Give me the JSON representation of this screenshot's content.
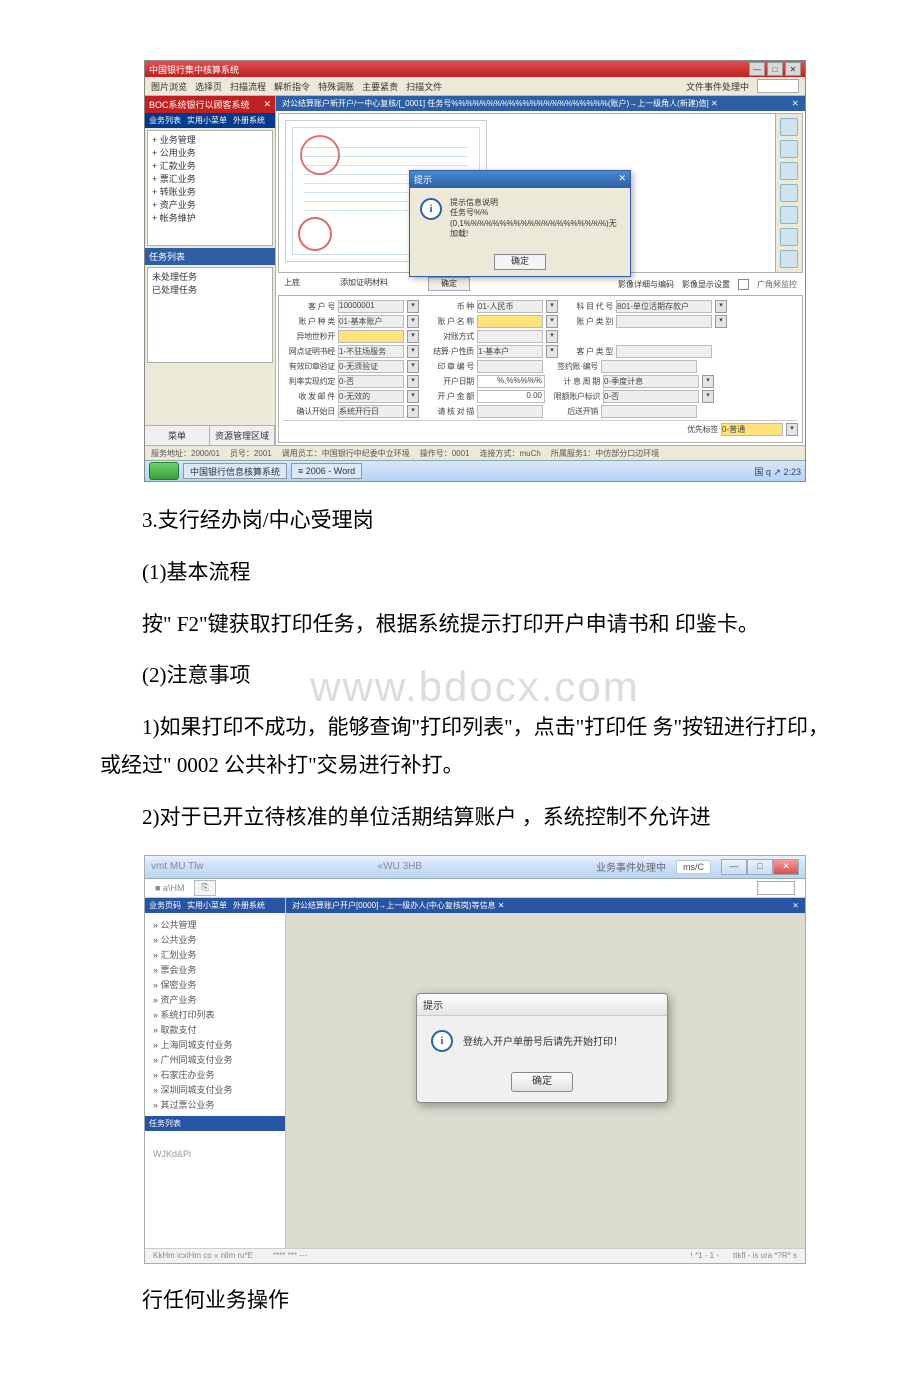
{
  "screenshot1": {
    "window_title": "中国银行集中核算系统",
    "menu": [
      "图片浏览",
      "选择页",
      "扫描流程",
      "解析指令",
      "特殊调账",
      "主要紧责",
      "扫描文件"
    ],
    "menu_right": "文件事件处理中",
    "toolbar": [
      "",
      ""
    ],
    "sidebar": {
      "header": "BOC系统银行以顾客系统",
      "sub_tabs": [
        "业务列表",
        "实用小菜单",
        "外册系统"
      ],
      "tree": [
        "+ 业务管理",
        "+ 公用业务",
        "+ 汇款业务",
        "+ 票汇业务",
        "+ 转账业务",
        "+ 资产业务",
        "+ 帐务维护"
      ],
      "task_header": "任务列表",
      "tasks": [
        "未处理任务",
        "已处理任务"
      ],
      "bottom_buttons": [
        "菜单",
        "资源管理区域"
      ]
    },
    "content": {
      "tab": "对公结算账户新开户/一中心复核/[_0001] 任务号%%%%%%%%%%%%%%%%%%%%%%(账户)→上一级角人(新建)值] ✕",
      "img_label_left": "上底",
      "img_label_left2": "添加证明材料",
      "img_nav_btn": "确定",
      "img_nav_prev": "影像详细与编码",
      "img_nav_next": "影像显示设置",
      "img_toggle": "广角频监控"
    },
    "dialog": {
      "title": "提示",
      "message_line1": "提示信息说明",
      "message_line2": "任务号%%(0,1%%%%%%%%%%%%%%%%%%%%)无加载!",
      "ok": "确定"
    },
    "form": {
      "rows": [
        {
          "l1": "客 户 号",
          "v1": "10000001",
          "l2": "币    种",
          "v2": "01-人民币",
          "l3": "科 目 代 号",
          "v3": "801-单位活期存款户"
        },
        {
          "l1": "账 户 种 类",
          "v1": "01-基本账户",
          "l2": "账 户 名 称",
          "v2": "",
          "l3": "账 户 类 别",
          "v3": ""
        },
        {
          "l1": "异地世秒开",
          "v1": "",
          "l2": "对账方式",
          "v2": "",
          "l3": "",
          "v3": ""
        },
        {
          "l1": "网点证明书经",
          "v1": "1-不驻场服务",
          "l2": "结算·户性质",
          "v2": "1-基本户",
          "l3": "客 户 类 型",
          "v3": ""
        },
        {
          "l1": "有效印章验证",
          "v1": "0-无须验证",
          "l2": "印 章 编 号",
          "v2": "",
          "l3": "签约账·编号",
          "v3": ""
        },
        {
          "l1": "利率实现约定",
          "v1": "0-否",
          "l2": "开户日期",
          "v2": "%,%%%%%",
          "l3": "计 息 周 期",
          "v3": "0-季度计息"
        },
        {
          "l1": "收 发 邮 件",
          "v1": "0-无效的",
          "l2": "开 户 金 额",
          "v2": "0.00",
          "l3": "限额账户标识",
          "v3": "0-否"
        },
        {
          "l1": "确认开始日",
          "v1": "系统开行日",
          "l2": "请 核 对 描",
          "v2": "",
          "l3": "后送开销",
          "v3": ""
        }
      ],
      "footer_l": "",
      "footer_r_lbl": "优先标签",
      "footer_r_val": "0-普通"
    },
    "statusbar": {
      "items": [
        "服务地址：2000/01",
        "员号：2001",
        "调用员工：中国银行中纪委中立环境",
        "操作号：0001",
        "连接方式：muCh",
        "所属服务1：中仿部分口边环境"
      ]
    },
    "taskbar": {
      "items": [
        "中国银行信息核算系统"
      ],
      "tray": "国 q ↗ 2:23"
    }
  },
  "body_text": {
    "p1": "3.支行经办岗/中心受理岗",
    "p2": "(1)基本流程",
    "p3": "按\" F2\"键获取打印任务，根据系统提示打印开户申请书和 印鉴卡。",
    "p4": "(2)注意事项",
    "p5": "1)如果打印不成功，能够查询\"打印列表\"，点击\"打印任 务\"按钮进行打印，或经过\" 0002 公共补打\"交易进行补打。",
    "p6": "2)对于已开立待核准的单位活期结算账户 ，系统控制不允许进",
    "p7": "行任何业务操作",
    "watermark": "www.bdocx.com"
  },
  "screenshot2": {
    "title_left": "vmt MU Tlw",
    "title_mid": "«WU 3HB",
    "title_right_status": "业务事件处理中",
    "title_right_pill": "ms/C",
    "subrow_left": "■ a\\HM",
    "subrow_tab": "⎘",
    "subrow_right": "",
    "sidebar": {
      "head_tabs": [
        "业务页码",
        "实用小菜单",
        "外册系统"
      ],
      "tree": [
        "» 公共管理",
        "» 公共业务",
        "» 汇划业务",
        "» 票会业务",
        "» 保密业务",
        "» 资产业务",
        "» 系统打印列表",
        "» 取款支付",
        "» 上海同城支付业务",
        "» 广州同城支付业务",
        "» 石家庄办业务",
        "» 深圳同城支付业务",
        "» 其过票公业务"
      ],
      "tasks_head": "任务列表",
      "tasks_body": "WJKd&Pi"
    },
    "content": {
      "tab": "对公结算账户开户[0000]→上一级办人(中心复核岗)等信息 ✕"
    },
    "dialog": {
      "title": "提示",
      "message": "登统入开户单册号后请先开始打印！",
      "ok": "确定"
    },
    "statusbar": {
      "left": "KkHm icxiHm  co «  nlim ru*E",
      "mid": "**** *** ---",
      "right": [
        "! *1 - 1 -",
        "ttkfl - is ura   *?R* s"
      ]
    }
  }
}
